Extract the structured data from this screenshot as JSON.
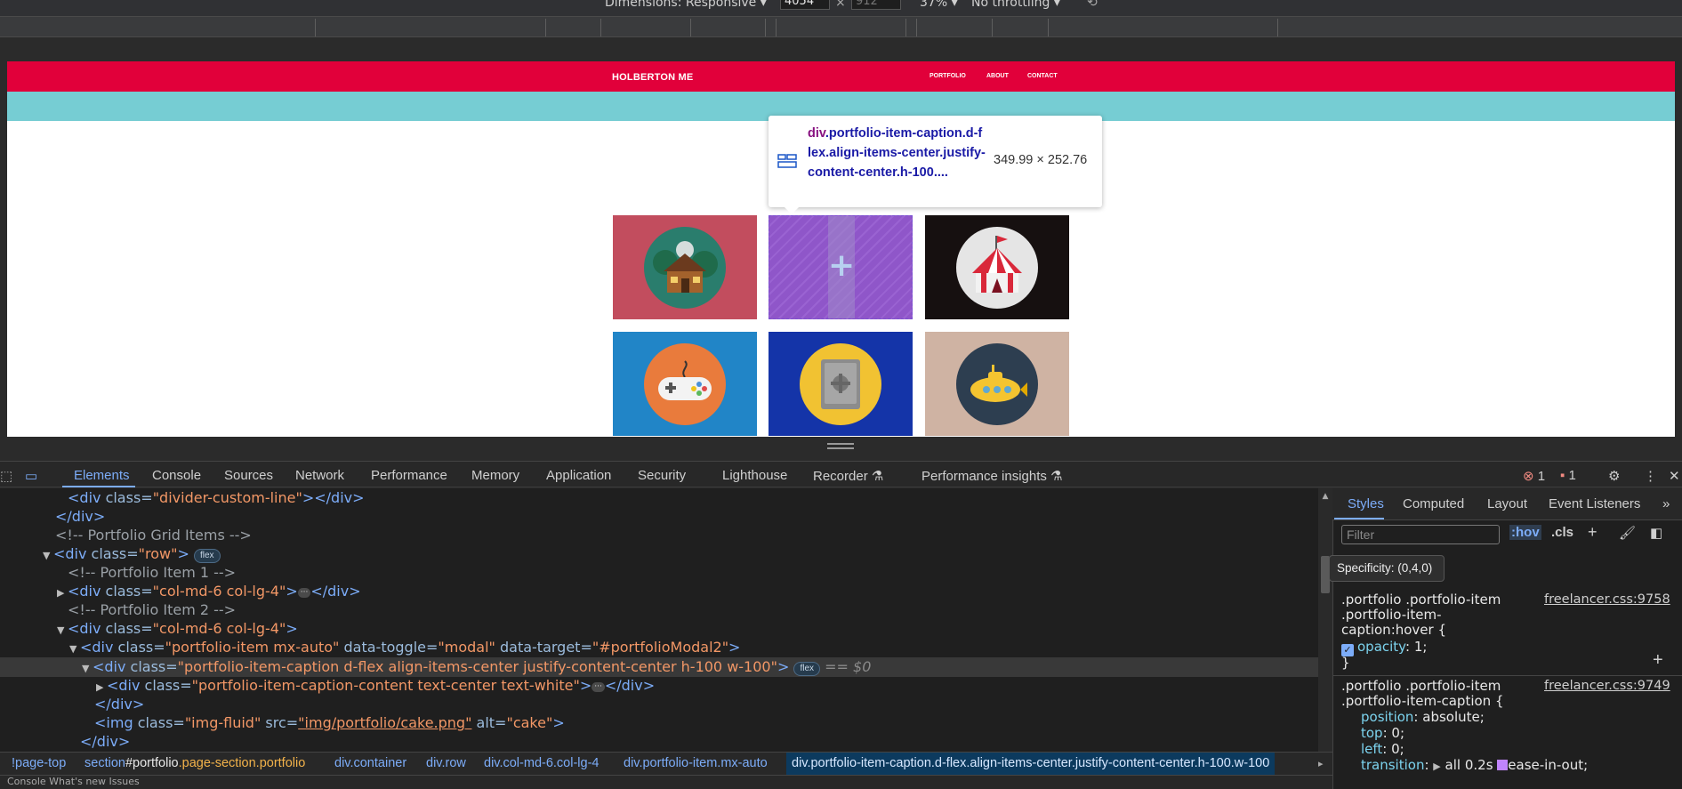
{
  "devtools_toolbar": {
    "dimensions_label": "Dimensions: Responsive",
    "width_value": "4054",
    "height_value": "912",
    "zoom": "37%",
    "throttling": "No throttling"
  },
  "page": {
    "brand": "HOLBERTON ME",
    "nav_links": [
      "PORTFOLIO",
      "ABOUT",
      "CONTACT"
    ],
    "tiles": [
      {
        "name": "cabin",
        "bg": "#c24d5e"
      },
      {
        "name": "cake",
        "bg": "#8f56c9"
      },
      {
        "name": "circus",
        "bg": "#161010"
      },
      {
        "name": "game",
        "bg": "#2185c7"
      },
      {
        "name": "safe",
        "bg": "#1434a8"
      },
      {
        "name": "submarine",
        "bg": "#cfb3a3"
      }
    ]
  },
  "inspect_tooltip": {
    "tag": "div",
    "selector": ".portfolio-item-caption.d-flex.align-items-center.justify-content-center.h-100....",
    "size": "349.99 × 252.76"
  },
  "devtools_tabs": [
    "Elements",
    "Console",
    "Sources",
    "Network",
    "Performance",
    "Memory",
    "Application",
    "Security",
    "Lighthouse",
    "Recorder",
    "Performance insights"
  ],
  "counts": {
    "errors": "1",
    "warnings": "1"
  },
  "dom_lines": [
    {
      "open": "<div ",
      "attr": "class=",
      "val": "\"divider-custom-line\"",
      "close": "></div>"
    },
    {
      "text": "</div>"
    },
    {
      "comment": "<!-- Portfolio Grid Items -->"
    },
    {
      "open": "<div ",
      "attr": "class=",
      "val": "\"row\"",
      "close": ">",
      "badge": "flex"
    },
    {
      "comment": "<!-- Portfolio Item 1 -->"
    },
    {
      "open": "<div ",
      "attr": "class=",
      "val": "\"col-md-6 col-lg-4\"",
      "close": ">",
      "end": "</div>"
    },
    {
      "comment": "<!-- Portfolio Item 2 -->"
    },
    {
      "open": "<div ",
      "attr": "class=",
      "val": "\"col-md-6 col-lg-4\"",
      "close": ">"
    },
    {
      "open": "<div ",
      "attr": "class=",
      "val": "\"portfolio-item mx-auto\"",
      "attr2": " data-toggle=",
      "val2": "\"modal\"",
      "attr3": " data-target=",
      "val3": "\"#portfolioModal2\"",
      "close": ">"
    },
    {
      "open": "<div ",
      "attr": "class=",
      "val": "\"portfolio-item-caption d-flex align-items-center justify-content-center h-100 w-100\"",
      "close": ">",
      "badge": "flex",
      "dollar": "== $0"
    },
    {
      "open": "<div ",
      "attr": "class=",
      "val": "\"portfolio-item-caption-content text-center text-white\"",
      "close": ">",
      "end": "</div>"
    },
    {
      "text": "</div>"
    },
    {
      "open": "<img ",
      "attr": "class=",
      "val": "\"img-fluid\"",
      "attr2": " src=",
      "val2": "\"img/portfolio/cake.png\"",
      "attr3": " alt=",
      "val3": "\"cake\"",
      "close": ">"
    },
    {
      "text": "</div>"
    }
  ],
  "breadcrumbs": [
    {
      "prefix": "",
      "text": "!page-top"
    },
    {
      "prefix": "section",
      "text": "#portfolio",
      "hi": ".page-section.portfolio"
    },
    {
      "prefix": "div",
      "text": ".container"
    },
    {
      "prefix": "div",
      "text": ".row"
    },
    {
      "prefix": "div",
      "text": ".col-md-6.col-lg-4"
    },
    {
      "prefix": "div",
      "text": ".portfolio-item.mx-auto"
    },
    {
      "prefix": "div",
      "text": ".portfolio-item-caption.d-flex.align-items-center.justify-content-center.h-100.w-100"
    }
  ],
  "styles": {
    "tabs": [
      "Styles",
      "Computed",
      "Layout",
      "Event Listeners"
    ],
    "filter_placeholder": "Filter",
    "hov": ":hov",
    "cls": ".cls",
    "specificity": "Specificity: (0,4,0)",
    "rule1": {
      "selector_lines": [
        ".portfolio .portfolio-item",
        ".portfolio-item-",
        "caption:hover {"
      ],
      "source": "freelancer.css:9758",
      "props": [
        {
          "name": "opacity",
          "value": "1;"
        }
      ]
    },
    "rule2": {
      "selector_lines": [
        ".portfolio .portfolio-item",
        ".portfolio-item-caption {"
      ],
      "source": "freelancer.css:9749",
      "props": [
        {
          "name": "position",
          "value": "absolute;"
        },
        {
          "name": "top",
          "value": "0;"
        },
        {
          "name": "left",
          "value": "0;"
        },
        {
          "name": "transition",
          "value": "all 0.2s",
          "extra": "ease-in-out;"
        }
      ]
    }
  },
  "bottom_strip": "Console   What's new   Issues"
}
